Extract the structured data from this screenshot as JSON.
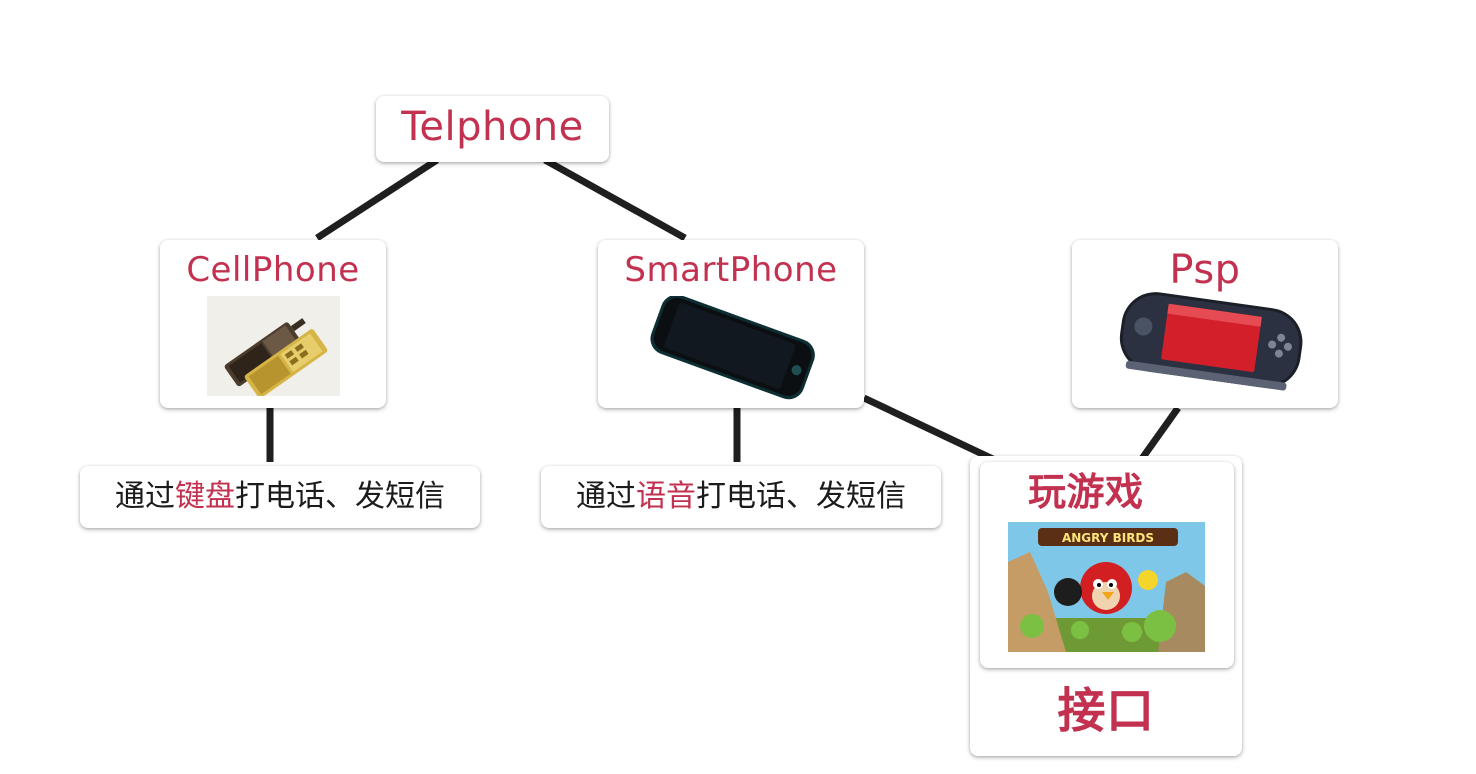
{
  "nodes": {
    "telphone": {
      "label": "Telphone"
    },
    "cellphone": {
      "label": "CellPhone"
    },
    "smartphone": {
      "label": "SmartPhone"
    },
    "psp": {
      "label": "Psp"
    },
    "game": {
      "label": "玩游戏"
    },
    "interface": {
      "label": "接口"
    }
  },
  "descriptions": {
    "cellphone": {
      "prefix": "通过",
      "highlight": "键盘",
      "suffix": "打电话、发短信"
    },
    "smartphone": {
      "prefix": "通过",
      "highlight": "语音",
      "suffix": "打电话、发短信"
    }
  },
  "images": {
    "game_logo": "ANGRY BIRDS"
  },
  "colors": {
    "accent": "#c2314f",
    "line": "#1f1f1f",
    "text": "#1b1b1b"
  }
}
